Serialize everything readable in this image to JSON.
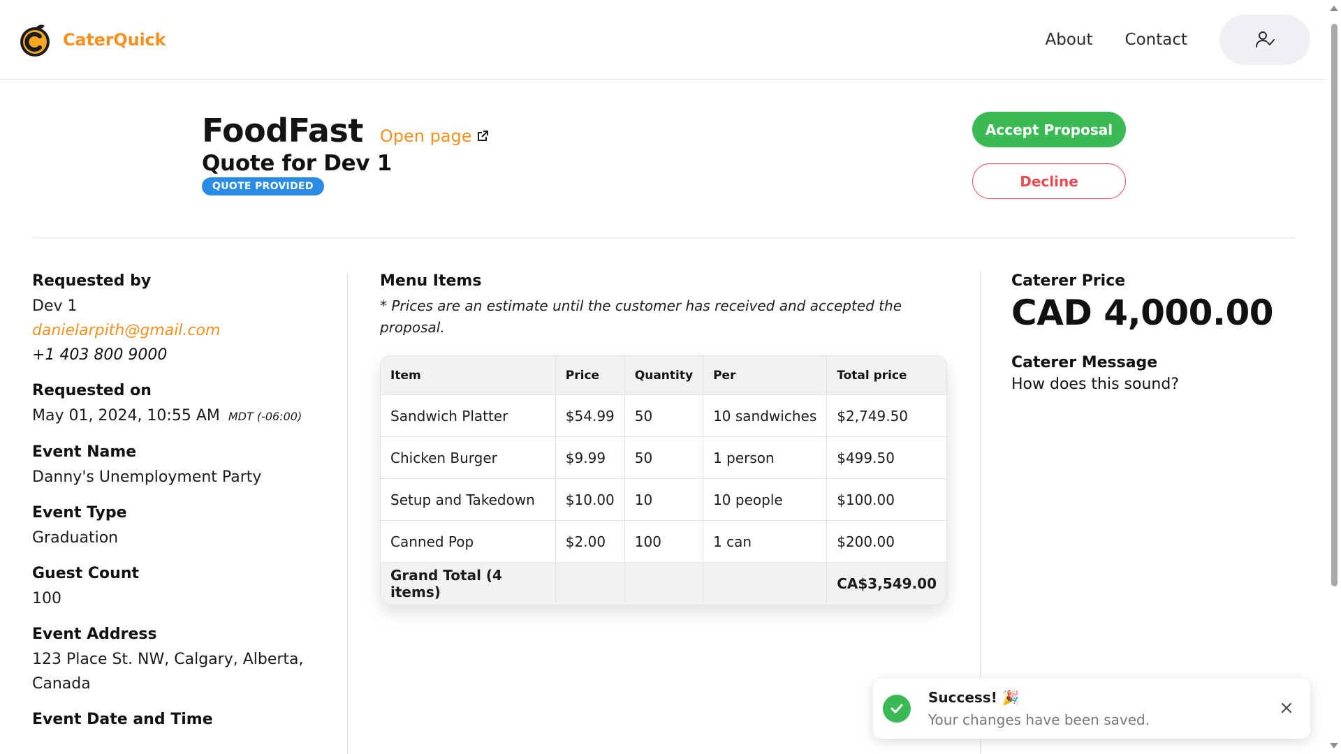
{
  "header": {
    "brand": "CaterQuick",
    "logo_icon": "orange-c-logo-icon",
    "nav": [
      {
        "label": "About"
      },
      {
        "label": "Contact"
      }
    ],
    "profile_icon": "user-check-icon"
  },
  "title": {
    "company": "FoodFast",
    "open_page": "Open page",
    "open_page_icon": "external-link-icon",
    "quote": "Quote for Dev 1",
    "status": "QUOTE PROVIDED"
  },
  "actions": {
    "accept": "Accept Proposal",
    "decline": "Decline"
  },
  "details": {
    "requested_by_label": "Requested by",
    "requested_by_name": "Dev 1",
    "email": "danielarpith@gmail.com",
    "phone": "+1 403 800 9000",
    "requested_on_label": "Requested on",
    "requested_on": "May 01, 2024, 10:55 AM",
    "timezone": "MDT (-06:00)",
    "event_name_label": "Event Name",
    "event_name": "Danny's Unemployment Party",
    "event_type_label": "Event Type",
    "event_type": "Graduation",
    "guest_count_label": "Guest Count",
    "guest_count": "100",
    "event_address_label": "Event Address",
    "event_address_line1": "123 Place St. NW, Calgary, Alberta,",
    "event_address_line2": "Canada",
    "event_datetime_label": "Event Date and Time"
  },
  "menu": {
    "title": "Menu Items",
    "note": "* Prices are an estimate until the customer has received and accepted the proposal.",
    "columns": [
      "Item",
      "Price",
      "Quantity",
      "Per",
      "Total price"
    ],
    "rows": [
      [
        "Sandwich Platter",
        "$54.99",
        "50",
        "10 sandwiches",
        "$2,749.50"
      ],
      [
        "Chicken Burger",
        "$9.99",
        "50",
        "1 person",
        "$499.50"
      ],
      [
        "Setup and Takedown",
        "$10.00",
        "10",
        "10 people",
        "$100.00"
      ],
      [
        "Canned Pop",
        "$2.00",
        "100",
        "1 can",
        "$200.00"
      ]
    ],
    "grand_total_label": "Grand Total (4 items)",
    "grand_total_value": "CA$3,549.00"
  },
  "caterer": {
    "price_label": "Caterer Price",
    "price": "CAD 4,000.00",
    "message_label": "Caterer Message",
    "message": "How does this sound?"
  },
  "toast": {
    "title": "Success! 🎉",
    "text": "Your changes have been saved.",
    "icon": "check-circle-icon",
    "close_icon": "close-icon"
  },
  "colors": {
    "brand": "#f5901e",
    "accept": "#3bb954",
    "decline": "#e84a55",
    "badge": "#2a8be4"
  }
}
